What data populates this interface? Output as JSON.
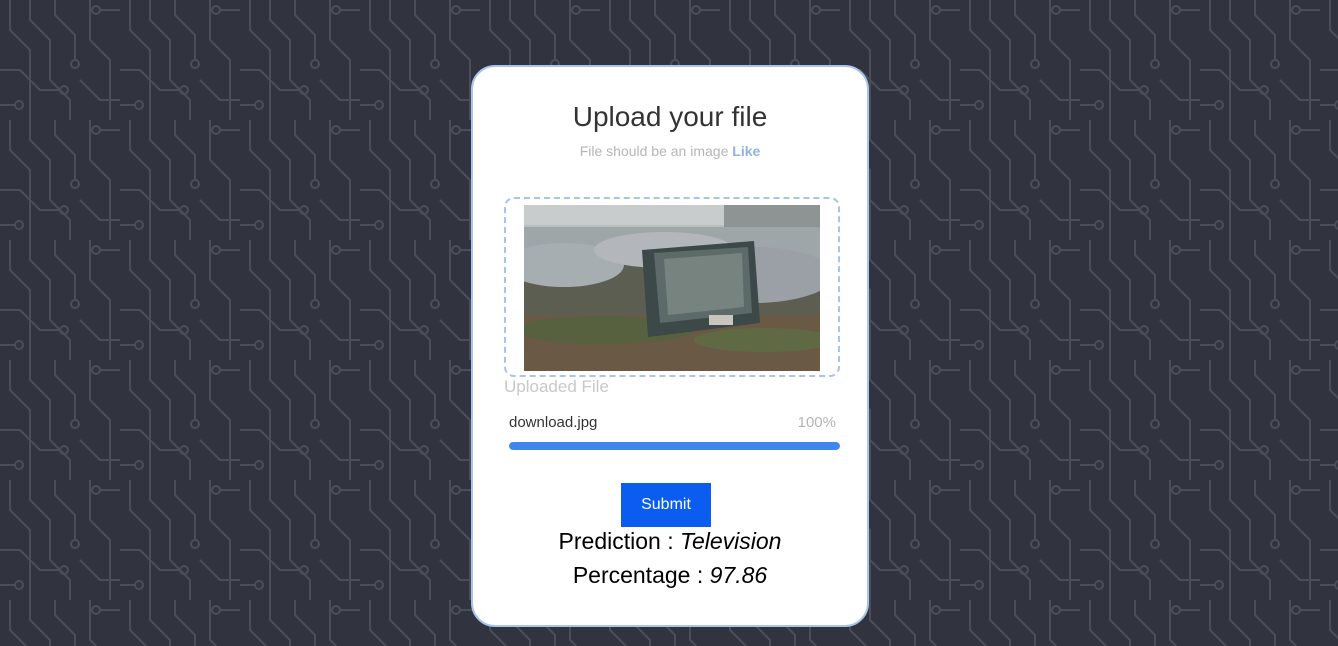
{
  "upload_card": {
    "title": "Upload your file",
    "subtitle_text": "File should be an image",
    "subtitle_link": "Like",
    "uploaded_label": "Uploaded File",
    "file": {
      "name": "download.jpg",
      "progress_text": "100%",
      "progress": 1.0
    },
    "submit_label": "Submit",
    "prediction": {
      "label": "Prediction : ",
      "value": "Television"
    },
    "percentage": {
      "label": "Percentage : ",
      "value": "97.86"
    }
  },
  "colors": {
    "background": "#31343e",
    "card_border": "#a9c4ec",
    "accent": "#0b5cf0",
    "progress": "#3f86f0"
  },
  "icons": [
    "uploaded-image-preview"
  ]
}
